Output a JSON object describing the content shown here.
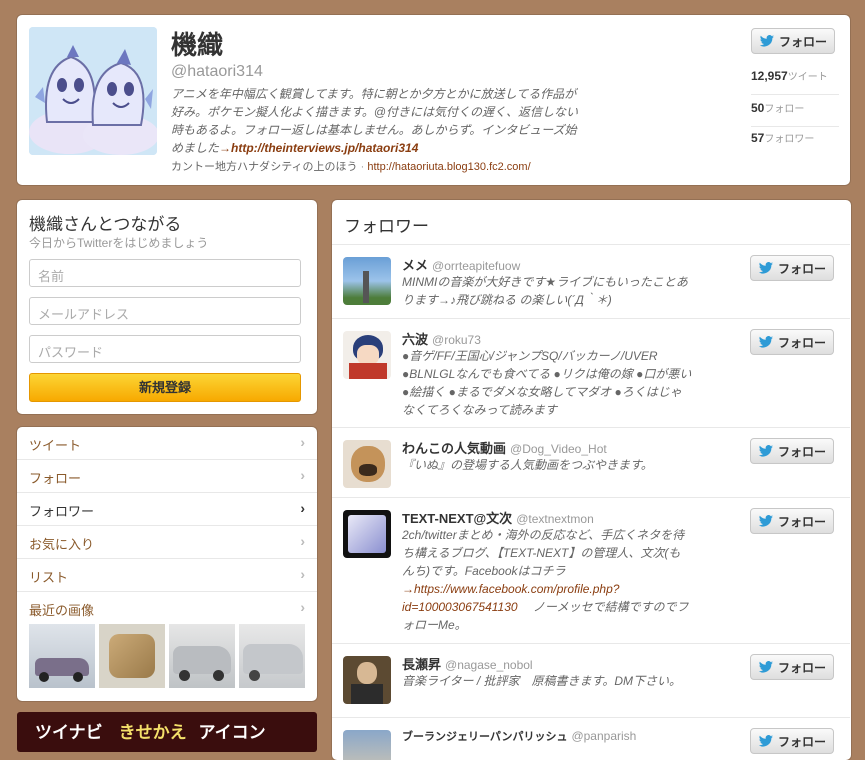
{
  "profile": {
    "name": "機織",
    "handle": "@hataori314",
    "bio": "アニメを年中幅広く観賞してます。特に朝とか夕方とかに放送してる作品が好み。ポケモン擬人化よく描きます。@付きには気付くの遅く、返信しない時もあるよ。フォロー返しは基本しません。あしからず。インタビューズ始めました",
    "bio_link": "→http://theinterviews.jp/hataori314",
    "location": "カントー地方ハナダシティの上のほう",
    "website": "http://hataoriuta.blog130.fc2.com/",
    "follow_label": "フォロー",
    "stats": [
      {
        "value": "12,957",
        "label": "ツイート"
      },
      {
        "value": "50",
        "label": "フォロー"
      },
      {
        "value": "57",
        "label": "フォロワー"
      }
    ]
  },
  "signup": {
    "title": "機織さんとつながる",
    "subtitle": "今日からTwitterをはじめましょう",
    "name_placeholder": "名前",
    "email_placeholder": "メールアドレス",
    "password_placeholder": "パスワード",
    "submit_label": "新規登録"
  },
  "nav": {
    "items": [
      {
        "label": "ツイート"
      },
      {
        "label": "フォロー"
      },
      {
        "label": "フォロワー"
      },
      {
        "label": "お気に入り"
      },
      {
        "label": "リスト"
      },
      {
        "label": "最近の画像"
      }
    ]
  },
  "banner": {
    "text1": "ツイナビ",
    "text2": "きせかえ",
    "text3": "アイコン"
  },
  "followers": {
    "title": "フォロワー",
    "follow_label": "フォロー",
    "items": [
      {
        "name": "メメ",
        "handle": "@orrteapitefuow",
        "bio": "MINMIの音楽が大好きです★ライブにもいったことあります→♪飛び跳ねる の楽しい(´Д｀＊)"
      },
      {
        "name": "六波",
        "handle": "@roku73",
        "bio": "●音ゲ/FF/王国心/ジャンプSQ/バッカーノ/UVER ●BLNLGLなんでも食べてる ●リクは俺の嫁 ●口が悪い ●絵描く ●まるでダメな女略してマダオ ●ろくはじゃなくてろくなみって読みます"
      },
      {
        "name": "わんこの人気動画",
        "handle": "@Dog_Video_Hot",
        "bio": "『いぬ』の登場する人気動画をつぶやきます。"
      },
      {
        "name": "TEXT-NEXT@文次",
        "handle": "@textnextmon",
        "bio": "2ch/twitterまとめ・海外の反応など、手広くネタを待ち構えるブログ、【TEXT-NEXT】の管理人、文次(もんち)です。Facebookはコチラ",
        "link": "→https://www.facebook.com/profile.php?id=100003067541130",
        "bio_tail": "ノーメッセで結構ですのでフォローMe。"
      },
      {
        "name": "長瀬昇",
        "handle": "@nagase_nobol",
        "bio": "音楽ライター / 批評家　原稿書きます。DM下さい。"
      },
      {
        "name": "ブーランジェリーパンパリッシュ",
        "handle": "@panparish",
        "bio": ""
      }
    ]
  }
}
